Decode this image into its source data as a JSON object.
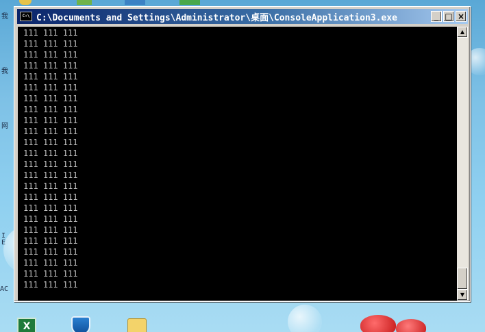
{
  "window": {
    "title": "C:\\Documents and Settings\\Administrator\\桌面\\ConsoleApplication3.exe",
    "app_icon": "console-icon",
    "app_icon_text": "C:\\",
    "buttons": {
      "minimize": "_",
      "maximize": "□",
      "close": "×"
    }
  },
  "console": {
    "text_color": "#c0c0c0",
    "background": "#000000",
    "lines": [
      "111 111 111",
      "111 111 111",
      "111 111 111",
      "111 111 111",
      "111 111 111",
      "111 111 111",
      "111 111 111",
      "111 111 111",
      "111 111 111",
      "111 111 111",
      "111 111 111",
      "111 111 111",
      "111 111 111",
      "111 111 111",
      "111 111 111",
      "111 111 111",
      "111 111 111",
      "111 111 111",
      "111 111 111",
      "111 111 111",
      "111 111 111",
      "111 111 111",
      "111 111 111",
      "111 111 111"
    ]
  },
  "scrollbar": {
    "up_arrow": "▲",
    "down_arrow": "▼",
    "position": 1.0
  },
  "desktop": {
    "left_labels": [
      "我",
      "我",
      "网",
      "I\nE",
      "AC"
    ],
    "colors": {
      "titlebar_start": "#0a246a",
      "titlebar_end": "#a6caf0",
      "desktop_bg": "#7ec1e6"
    }
  }
}
